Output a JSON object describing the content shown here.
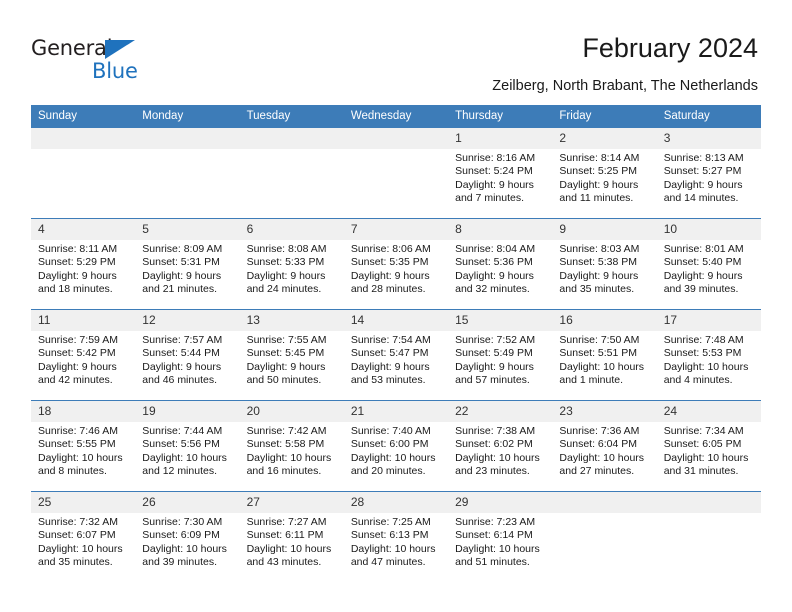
{
  "brand": {
    "name_top": "General",
    "name_bottom": "Blue",
    "color_blue": "#1f72bd",
    "color_dark": "#231f20",
    "triangle_icon": "triangle-icon"
  },
  "header": {
    "title": "February 2024",
    "subtitle": "Zeilberg, North Brabant, The Netherlands"
  },
  "theme": {
    "header_blue": "#3d7cb8",
    "daynum_gray": "#f0f0f0",
    "grid_line": "#3d7cb8"
  },
  "weekday_headers": [
    "Sunday",
    "Monday",
    "Tuesday",
    "Wednesday",
    "Thursday",
    "Friday",
    "Saturday"
  ],
  "weeks": [
    [
      {
        "day": "",
        "sunrise": "",
        "sunset": "",
        "daylight_1": "",
        "daylight_2": "",
        "blank": true
      },
      {
        "day": "",
        "sunrise": "",
        "sunset": "",
        "daylight_1": "",
        "daylight_2": "",
        "blank": true
      },
      {
        "day": "",
        "sunrise": "",
        "sunset": "",
        "daylight_1": "",
        "daylight_2": "",
        "blank": true
      },
      {
        "day": "",
        "sunrise": "",
        "sunset": "",
        "daylight_1": "",
        "daylight_2": "",
        "blank": true
      },
      {
        "day": "1",
        "sunrise": "Sunrise: 8:16 AM",
        "sunset": "Sunset: 5:24 PM",
        "daylight_1": "Daylight: 9 hours",
        "daylight_2": "and 7 minutes."
      },
      {
        "day": "2",
        "sunrise": "Sunrise: 8:14 AM",
        "sunset": "Sunset: 5:25 PM",
        "daylight_1": "Daylight: 9 hours",
        "daylight_2": "and 11 minutes."
      },
      {
        "day": "3",
        "sunrise": "Sunrise: 8:13 AM",
        "sunset": "Sunset: 5:27 PM",
        "daylight_1": "Daylight: 9 hours",
        "daylight_2": "and 14 minutes."
      }
    ],
    [
      {
        "day": "4",
        "sunrise": "Sunrise: 8:11 AM",
        "sunset": "Sunset: 5:29 PM",
        "daylight_1": "Daylight: 9 hours",
        "daylight_2": "and 18 minutes."
      },
      {
        "day": "5",
        "sunrise": "Sunrise: 8:09 AM",
        "sunset": "Sunset: 5:31 PM",
        "daylight_1": "Daylight: 9 hours",
        "daylight_2": "and 21 minutes."
      },
      {
        "day": "6",
        "sunrise": "Sunrise: 8:08 AM",
        "sunset": "Sunset: 5:33 PM",
        "daylight_1": "Daylight: 9 hours",
        "daylight_2": "and 24 minutes."
      },
      {
        "day": "7",
        "sunrise": "Sunrise: 8:06 AM",
        "sunset": "Sunset: 5:35 PM",
        "daylight_1": "Daylight: 9 hours",
        "daylight_2": "and 28 minutes."
      },
      {
        "day": "8",
        "sunrise": "Sunrise: 8:04 AM",
        "sunset": "Sunset: 5:36 PM",
        "daylight_1": "Daylight: 9 hours",
        "daylight_2": "and 32 minutes."
      },
      {
        "day": "9",
        "sunrise": "Sunrise: 8:03 AM",
        "sunset": "Sunset: 5:38 PM",
        "daylight_1": "Daylight: 9 hours",
        "daylight_2": "and 35 minutes."
      },
      {
        "day": "10",
        "sunrise": "Sunrise: 8:01 AM",
        "sunset": "Sunset: 5:40 PM",
        "daylight_1": "Daylight: 9 hours",
        "daylight_2": "and 39 minutes."
      }
    ],
    [
      {
        "day": "11",
        "sunrise": "Sunrise: 7:59 AM",
        "sunset": "Sunset: 5:42 PM",
        "daylight_1": "Daylight: 9 hours",
        "daylight_2": "and 42 minutes."
      },
      {
        "day": "12",
        "sunrise": "Sunrise: 7:57 AM",
        "sunset": "Sunset: 5:44 PM",
        "daylight_1": "Daylight: 9 hours",
        "daylight_2": "and 46 minutes."
      },
      {
        "day": "13",
        "sunrise": "Sunrise: 7:55 AM",
        "sunset": "Sunset: 5:45 PM",
        "daylight_1": "Daylight: 9 hours",
        "daylight_2": "and 50 minutes."
      },
      {
        "day": "14",
        "sunrise": "Sunrise: 7:54 AM",
        "sunset": "Sunset: 5:47 PM",
        "daylight_1": "Daylight: 9 hours",
        "daylight_2": "and 53 minutes."
      },
      {
        "day": "15",
        "sunrise": "Sunrise: 7:52 AM",
        "sunset": "Sunset: 5:49 PM",
        "daylight_1": "Daylight: 9 hours",
        "daylight_2": "and 57 minutes."
      },
      {
        "day": "16",
        "sunrise": "Sunrise: 7:50 AM",
        "sunset": "Sunset: 5:51 PM",
        "daylight_1": "Daylight: 10 hours",
        "daylight_2": "and 1 minute."
      },
      {
        "day": "17",
        "sunrise": "Sunrise: 7:48 AM",
        "sunset": "Sunset: 5:53 PM",
        "daylight_1": "Daylight: 10 hours",
        "daylight_2": "and 4 minutes."
      }
    ],
    [
      {
        "day": "18",
        "sunrise": "Sunrise: 7:46 AM",
        "sunset": "Sunset: 5:55 PM",
        "daylight_1": "Daylight: 10 hours",
        "daylight_2": "and 8 minutes."
      },
      {
        "day": "19",
        "sunrise": "Sunrise: 7:44 AM",
        "sunset": "Sunset: 5:56 PM",
        "daylight_1": "Daylight: 10 hours",
        "daylight_2": "and 12 minutes."
      },
      {
        "day": "20",
        "sunrise": "Sunrise: 7:42 AM",
        "sunset": "Sunset: 5:58 PM",
        "daylight_1": "Daylight: 10 hours",
        "daylight_2": "and 16 minutes."
      },
      {
        "day": "21",
        "sunrise": "Sunrise: 7:40 AM",
        "sunset": "Sunset: 6:00 PM",
        "daylight_1": "Daylight: 10 hours",
        "daylight_2": "and 20 minutes."
      },
      {
        "day": "22",
        "sunrise": "Sunrise: 7:38 AM",
        "sunset": "Sunset: 6:02 PM",
        "daylight_1": "Daylight: 10 hours",
        "daylight_2": "and 23 minutes."
      },
      {
        "day": "23",
        "sunrise": "Sunrise: 7:36 AM",
        "sunset": "Sunset: 6:04 PM",
        "daylight_1": "Daylight: 10 hours",
        "daylight_2": "and 27 minutes."
      },
      {
        "day": "24",
        "sunrise": "Sunrise: 7:34 AM",
        "sunset": "Sunset: 6:05 PM",
        "daylight_1": "Daylight: 10 hours",
        "daylight_2": "and 31 minutes."
      }
    ],
    [
      {
        "day": "25",
        "sunrise": "Sunrise: 7:32 AM",
        "sunset": "Sunset: 6:07 PM",
        "daylight_1": "Daylight: 10 hours",
        "daylight_2": "and 35 minutes."
      },
      {
        "day": "26",
        "sunrise": "Sunrise: 7:30 AM",
        "sunset": "Sunset: 6:09 PM",
        "daylight_1": "Daylight: 10 hours",
        "daylight_2": "and 39 minutes."
      },
      {
        "day": "27",
        "sunrise": "Sunrise: 7:27 AM",
        "sunset": "Sunset: 6:11 PM",
        "daylight_1": "Daylight: 10 hours",
        "daylight_2": "and 43 minutes."
      },
      {
        "day": "28",
        "sunrise": "Sunrise: 7:25 AM",
        "sunset": "Sunset: 6:13 PM",
        "daylight_1": "Daylight: 10 hours",
        "daylight_2": "and 47 minutes."
      },
      {
        "day": "29",
        "sunrise": "Sunrise: 7:23 AM",
        "sunset": "Sunset: 6:14 PM",
        "daylight_1": "Daylight: 10 hours",
        "daylight_2": "and 51 minutes."
      },
      {
        "day": "",
        "sunrise": "",
        "sunset": "",
        "daylight_1": "",
        "daylight_2": "",
        "blank": true
      },
      {
        "day": "",
        "sunrise": "",
        "sunset": "",
        "daylight_1": "",
        "daylight_2": "",
        "blank": true
      }
    ]
  ]
}
